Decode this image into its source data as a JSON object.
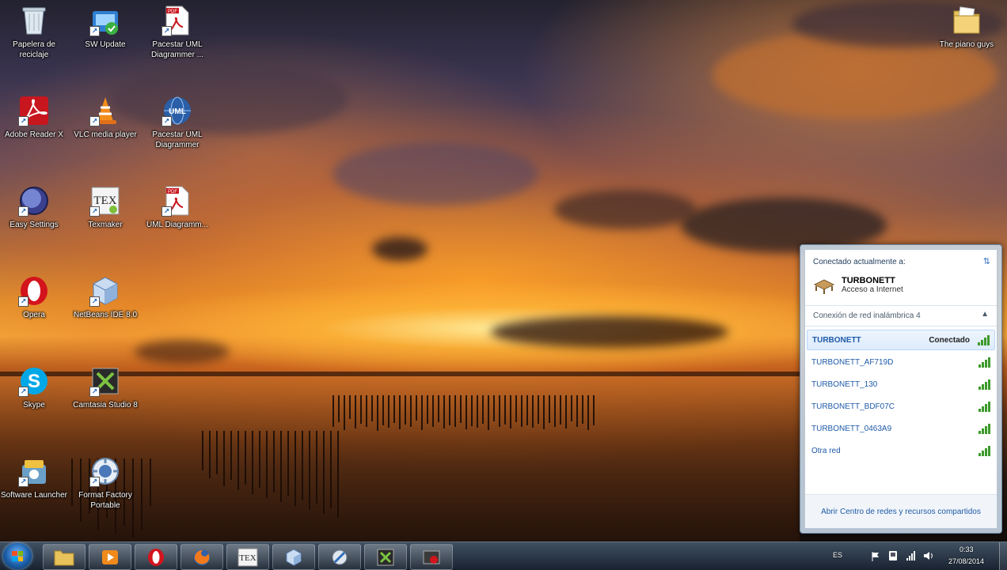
{
  "desktop": {
    "icons": [
      {
        "label": "Papelera de reciclaje"
      },
      {
        "label": "SW Update"
      },
      {
        "label": "Pacestar UML Diagrammer ..."
      },
      {
        "label": "Adobe Reader X"
      },
      {
        "label": "VLC media player"
      },
      {
        "label": "Pacestar UML Diagrammer"
      },
      {
        "label": "Easy Settings"
      },
      {
        "label": "Texmaker"
      },
      {
        "label": "UML Diagramm..."
      },
      {
        "label": "Opera"
      },
      {
        "label": "NetBeans IDE 8.0"
      },
      {
        "label": "Skype"
      },
      {
        "label": "Camtasia Studio 8"
      },
      {
        "label": "Software Launcher"
      },
      {
        "label": "Format Factory Portable"
      },
      {
        "label": "The piano guys"
      }
    ],
    "pdf_badge": "PDF",
    "tex_text": "TEX",
    "uml_text": "UML"
  },
  "wifi_popup": {
    "header": "Conectado actualmente a:",
    "current": {
      "name": "TURBONETT",
      "status": "Acceso a Internet"
    },
    "section": "Conexión de red inalámbrica 4",
    "networks": [
      {
        "name": "TURBONETT",
        "status": "Conectado"
      },
      {
        "name": "TURBONETT_AF719D",
        "status": ""
      },
      {
        "name": "TURBONETT_130",
        "status": ""
      },
      {
        "name": "TURBONETT_BDF07C",
        "status": ""
      },
      {
        "name": "TURBONETT_0463A9",
        "status": ""
      },
      {
        "name": "Otra red",
        "status": ""
      }
    ],
    "footer_link": "Abrir Centro de redes y recursos compartidos"
  },
  "taskbar": {
    "lang": "ES",
    "time": "0:33",
    "date": "27/08/2014",
    "tex_text": "TEX"
  },
  "colors": {
    "link_blue": "#1e5aa8",
    "signal_green": "#3c9a2c",
    "popup_border": "#6f8aa5"
  }
}
